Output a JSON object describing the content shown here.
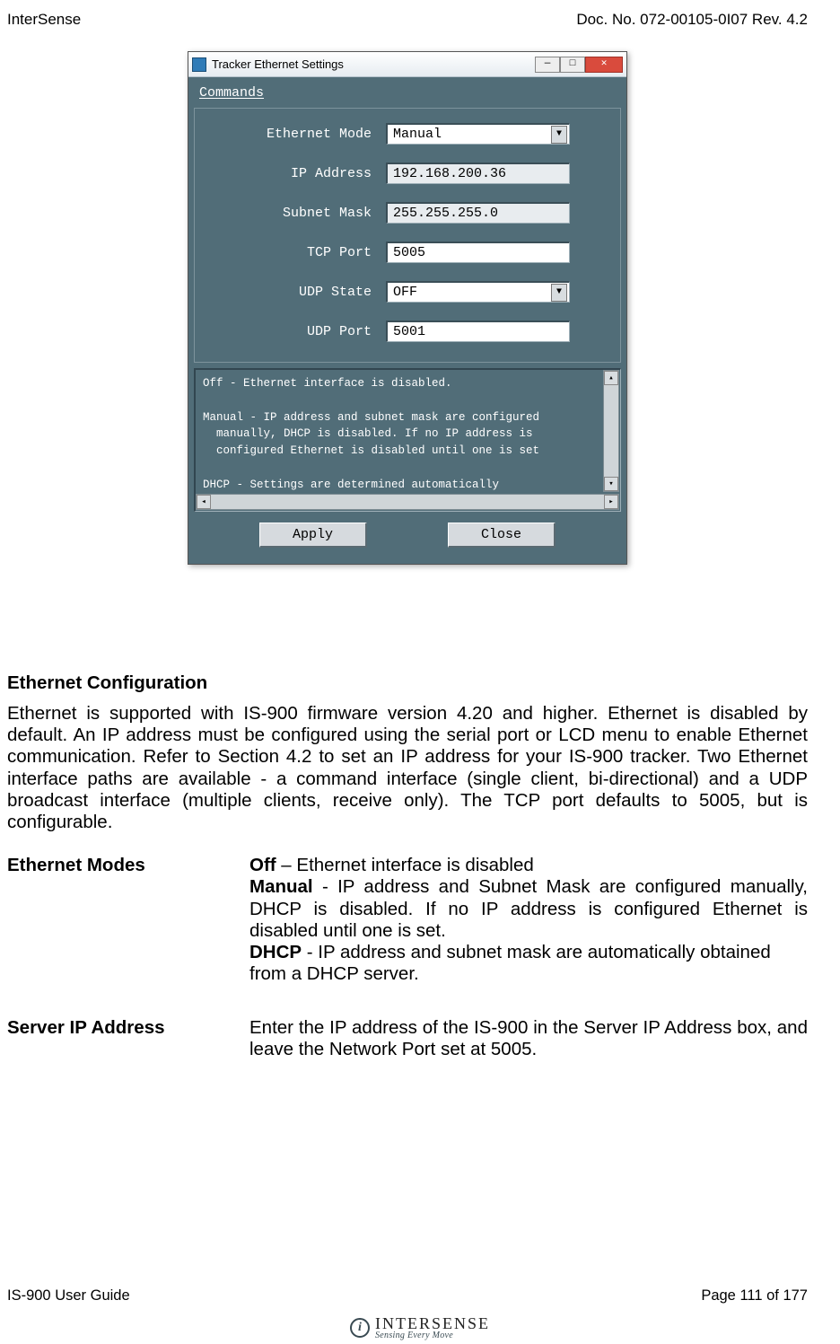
{
  "header": {
    "left": "InterSense",
    "right": "Doc. No. 072-00105-0I07 Rev. 4.2"
  },
  "dialog": {
    "title": "Tracker Ethernet Settings",
    "menu": {
      "commands": "Commands"
    },
    "fields": {
      "ethernet_mode": {
        "label": "Ethernet Mode",
        "value": "Manual"
      },
      "ip_address": {
        "label": "IP Address",
        "value": "192.168.200.36"
      },
      "subnet_mask": {
        "label": "Subnet Mask",
        "value": "255.255.255.0"
      },
      "tcp_port": {
        "label": "TCP Port",
        "value": "5005"
      },
      "udp_state": {
        "label": "UDP State",
        "value": "OFF"
      },
      "udp_port": {
        "label": "UDP Port",
        "value": "5001"
      }
    },
    "info_text": "Off - Ethernet interface is disabled.\n\nManual - IP address and subnet mask are configured\n  manually, DHCP is disabled. If no IP address is\n  configured Ethernet is disabled until one is set\n\nDHCP - Settings are determined automatically",
    "buttons": {
      "apply": "Apply",
      "close": "Close"
    }
  },
  "section": {
    "title": "Ethernet Configuration",
    "paragraph": "Ethernet is supported with IS-900 firmware version 4.20 and higher.  Ethernet is disabled by default.  An IP address must be configured using the serial port or LCD menu to enable Ethernet communication.  Refer to Section 4.2 to set an IP address for your IS-900 tracker.  Two Ethernet interface paths are available - a command interface (single client, bi-directional) and a UDP broadcast interface (multiple clients, receive only).  The TCP port defaults to 5005, but is configurable.",
    "modes": {
      "term": "Ethernet Modes",
      "off_b": "Off",
      "off_t": " – Ethernet interface is disabled",
      "manual_b": "Manual",
      "manual_t": " - IP address and Subnet Mask are configured manually, DHCP is disabled.  If no IP address is configured Ethernet is disabled until one is set.",
      "dhcp_b": "DHCP",
      "dhcp_t": " - IP address and subnet mask are automatically obtained from a DHCP server."
    },
    "server_ip": {
      "term": "Server IP Address",
      "text": "Enter the IP address of the IS-900 in the Server IP Address box, and leave the Network Port set at 5005."
    }
  },
  "footer": {
    "left": "IS-900 User Guide",
    "right": "Page 111 of 177"
  },
  "logo": {
    "main": "INTERSENSE",
    "sub": "Sensing Every Move"
  }
}
